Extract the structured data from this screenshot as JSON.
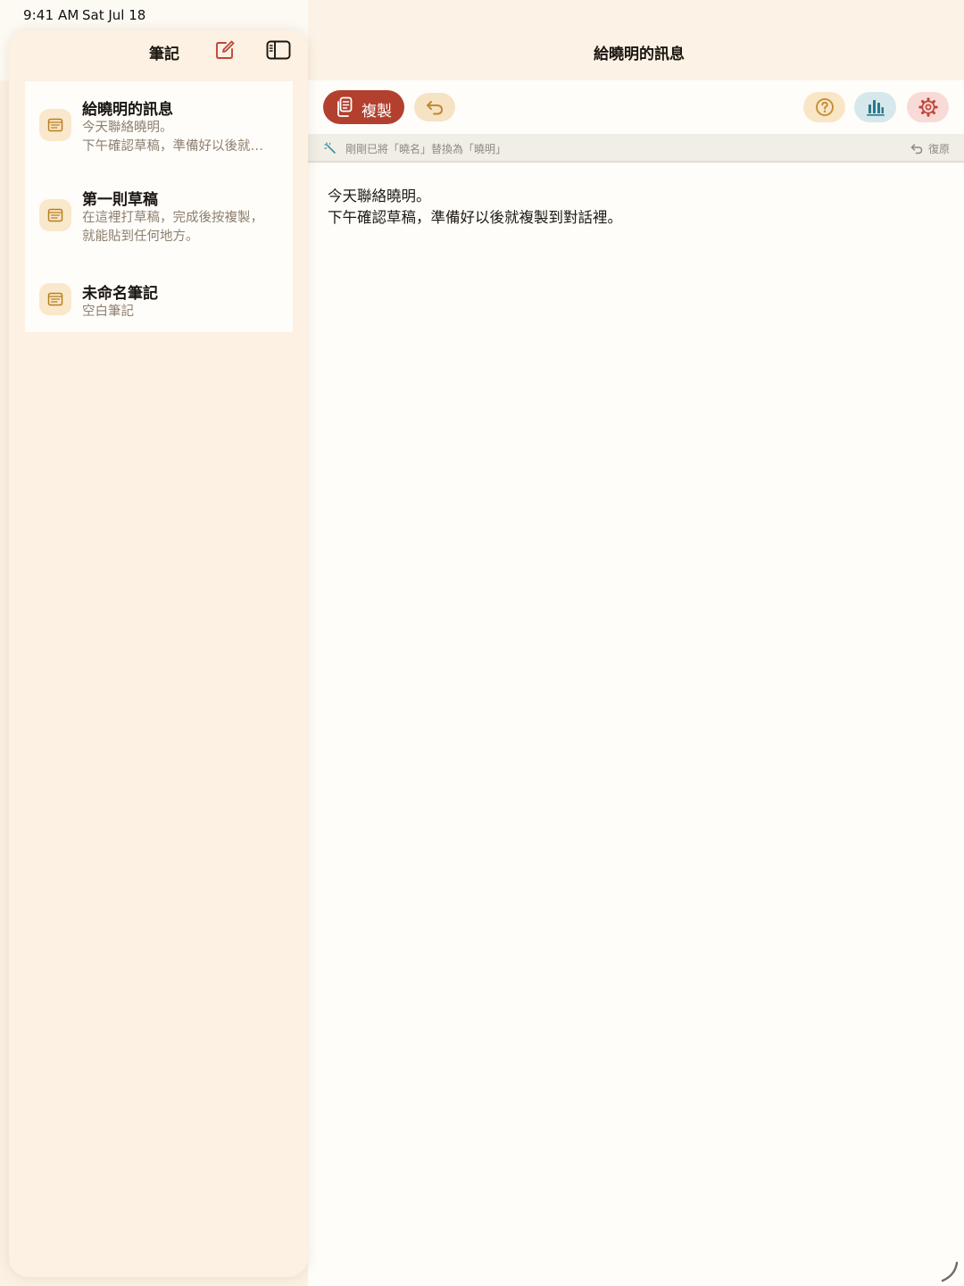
{
  "status_bar": {
    "time": "9:41 AM",
    "date": "Sat Jul 18"
  },
  "sidebar": {
    "title": "筆記",
    "notes": [
      {
        "title": "給曉明的訊息",
        "preview_line1": "今天聯絡曉明。",
        "preview_line2": "下午確認草稿，準備好以後就…"
      },
      {
        "title": "第一則草稿",
        "preview_line1": "在這裡打草稿，完成後按複製，",
        "preview_line2": "就能貼到任何地方。"
      },
      {
        "title": "未命名筆記",
        "preview_line1": "空白筆記",
        "preview_line2": ""
      }
    ]
  },
  "detail": {
    "title": "給曉明的訊息"
  },
  "toolbar": {
    "copy_label": "複製"
  },
  "banner": {
    "message": "剛剛已將「曉名」替換為「曉明」",
    "revert_label": "復原"
  },
  "editor": {
    "lines": [
      "今天聯絡曉明。",
      "下午確認草稿，準備好以後就複製到對話裡。"
    ]
  },
  "colors": {
    "accent": "#b3402e",
    "sidebar_bg": "#fcf1e2",
    "editor_bg": "#fffdf9",
    "battery": "#34c759"
  }
}
